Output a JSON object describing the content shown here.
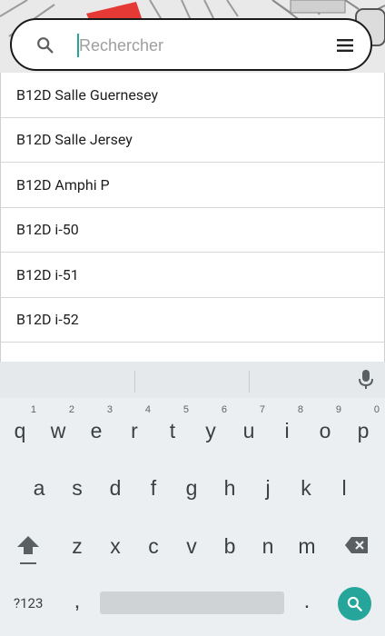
{
  "search": {
    "placeholder": "Rechercher"
  },
  "results": [
    "B12D Salle Guernesey",
    "B12D Salle Jersey",
    "B12D Amphi P",
    "B12D i-50",
    "B12D i-51",
    "B12D i-52"
  ],
  "keyboard": {
    "row1": [
      {
        "key": "q",
        "hint": "1"
      },
      {
        "key": "w",
        "hint": "2"
      },
      {
        "key": "e",
        "hint": "3"
      },
      {
        "key": "r",
        "hint": "4"
      },
      {
        "key": "t",
        "hint": "5"
      },
      {
        "key": "y",
        "hint": "6"
      },
      {
        "key": "u",
        "hint": "7"
      },
      {
        "key": "i",
        "hint": "8"
      },
      {
        "key": "o",
        "hint": "9"
      },
      {
        "key": "p",
        "hint": "0"
      }
    ],
    "row2": [
      "a",
      "s",
      "d",
      "f",
      "g",
      "h",
      "j",
      "k",
      "l"
    ],
    "row3": [
      "z",
      "x",
      "c",
      "v",
      "b",
      "n",
      "m"
    ],
    "symbols_label": "?123",
    "comma": ",",
    "period": "."
  },
  "colors": {
    "accent": "#26a69a",
    "map_red": "#e53935"
  }
}
